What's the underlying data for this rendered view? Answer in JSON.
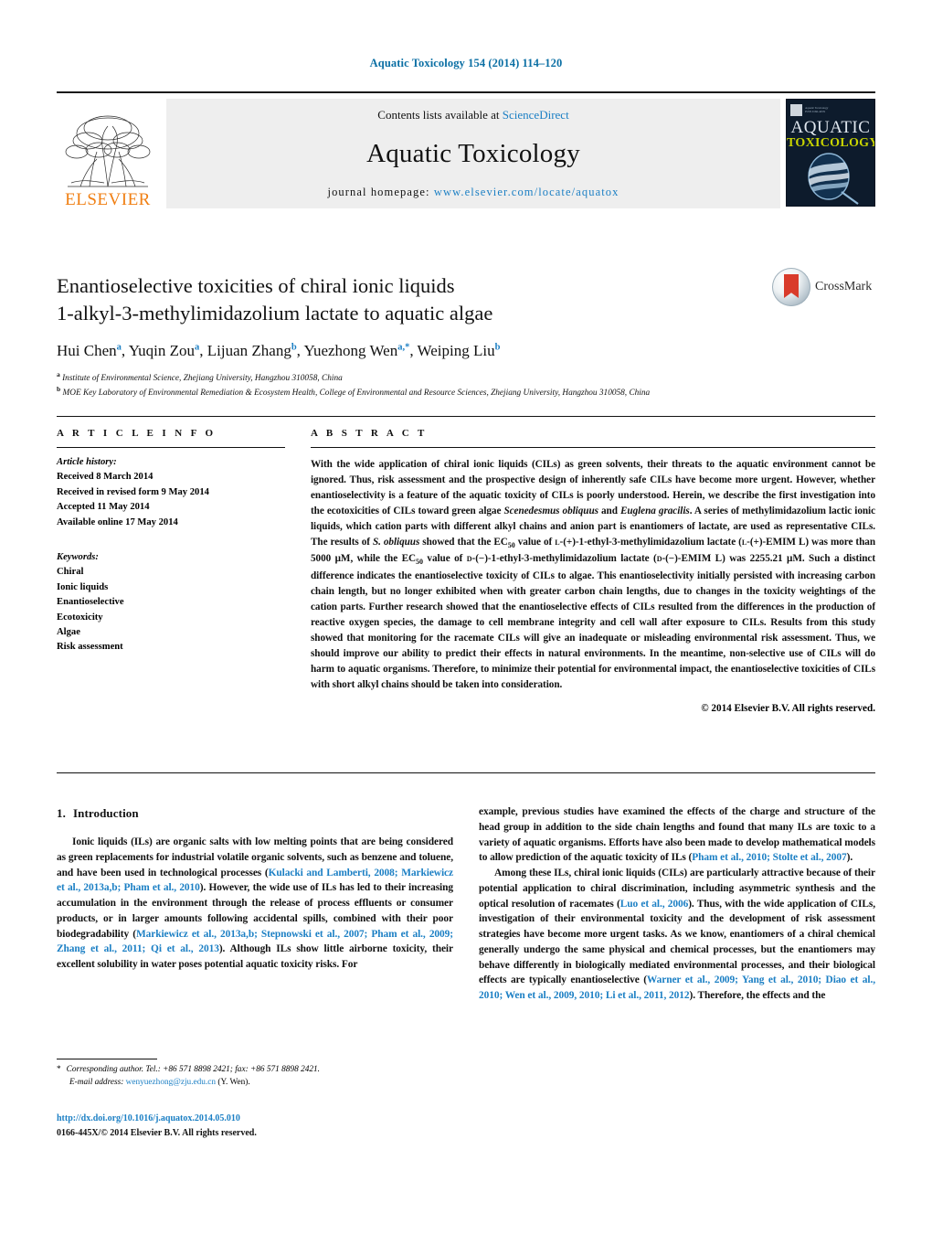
{
  "running_head": "Aquatic Toxicology 154 (2014) 114–120",
  "masthead": {
    "contents_prefix": "Contents lists available at ",
    "sciencedirect": "ScienceDirect",
    "journal_title": "Aquatic Toxicology",
    "homepage_prefix": "journal homepage:",
    "homepage_url": "www.elsevier.com/locate/aquatox",
    "publisher_wordmark": "ELSEVIER",
    "cover": {
      "line1": "AQUATIC",
      "line2": "TOXICOLOGY",
      "tiny_line1": "Aquatic Toxicology",
      "tiny_line2": "ISSN 0166-445X"
    }
  },
  "crossmark": {
    "label": "CrossMark"
  },
  "title": {
    "line1": "Enantioselective toxicities of chiral ionic liquids",
    "line2": "1-alkyl-3-methylimidazolium lactate to aquatic algae"
  },
  "authors": [
    {
      "name": "Hui Chen",
      "sup": "a",
      "sep": ", "
    },
    {
      "name": "Yuqin Zou",
      "sup": "a",
      "sep": ", "
    },
    {
      "name": "Lijuan Zhang",
      "sup": "b",
      "sep": ", "
    },
    {
      "name": "Yuezhong Wen",
      "sup": "a,*",
      "sep": ", "
    },
    {
      "name": "Weiping Liu",
      "sup": "b",
      "sep": ""
    }
  ],
  "affiliations": [
    {
      "label": "a",
      "text": "Institute of Environmental Science, Zhejiang University, Hangzhou 310058, China"
    },
    {
      "label": "b",
      "text": "MOE Key Laboratory of Environmental Remediation & Ecosystem Health, College of Environmental and Resource Sciences, Zhejiang University, Hangzhou 310058, China"
    }
  ],
  "article_info": {
    "heading": "A R T I C L E    I N F O",
    "history_label": "Article history:",
    "history": [
      "Received 8 March 2014",
      "Received in revised form 9 May 2014",
      "Accepted 11 May 2014",
      "Available online 17 May 2014"
    ],
    "keywords_label": "Keywords:",
    "keywords": [
      "Chiral",
      "Ionic liquids",
      "Enantioselective",
      "Ecotoxicity",
      "Algae",
      "Risk assessment"
    ]
  },
  "abstract": {
    "heading": "A B S T R A C T",
    "copyright": "© 2014 Elsevier B.V. All rights reserved."
  },
  "introduction": {
    "heading_number": "1.",
    "heading_text": "Introduction"
  },
  "footnote": {
    "corresponding": "Corresponding author. Tel.: +86 571 8898 2421; fax: +86 571 8898 2421.",
    "email_label": "E-mail address:",
    "email": "wenyuezhong@zju.edu.cn",
    "email_suffix": "(Y. Wen)."
  },
  "doi": {
    "url": "http://dx.doi.org/10.1016/j.aquatox.2014.05.010",
    "issn_line": "0166-445X/© 2014 Elsevier B.V. All rights reserved."
  },
  "colors": {
    "link": "#1b7fc4",
    "running_head": "#0b6fa4",
    "elsevier_orange": "#f07f13",
    "cover_bg": "#0d1b2c",
    "cover_yellow": "#c9d400"
  }
}
